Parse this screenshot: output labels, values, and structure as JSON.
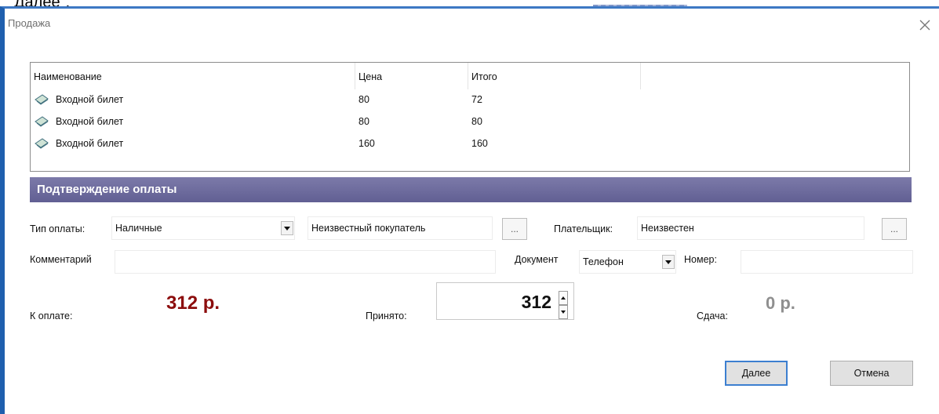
{
  "caption_top": "Далее\".",
  "window": {
    "title": "Продажа"
  },
  "table": {
    "columns": [
      "Наименование",
      "Цена",
      "Итого"
    ],
    "rows": [
      {
        "name": "Входной билет",
        "price": "80",
        "total": "72"
      },
      {
        "name": "Входной билет",
        "price": "80",
        "total": "80"
      },
      {
        "name": "Входной билет",
        "price": "160",
        "total": "160"
      }
    ]
  },
  "section": {
    "title": "Подтверждение оплаты"
  },
  "form": {
    "payment_type_label": "Тип оплаты:",
    "payment_type_value": "Наличные",
    "buyer_value": "Неизвестный покупатель",
    "payer_label": "Плательщик:",
    "payer_value": "Неизвестен",
    "comment_label": "Комментарий",
    "comment_value": "",
    "document_label": "Документ",
    "document_value": "Телефон",
    "number_label": "Номер:",
    "number_value": "",
    "ellipsis": "..."
  },
  "totals": {
    "to_pay_label": "К оплате:",
    "to_pay_value": "312 р.",
    "accepted_label": "Принято:",
    "accepted_value": "312",
    "change_label": "Сдача:",
    "change_value": "0 р."
  },
  "buttons": {
    "next": "Далее",
    "cancel": "Отмена"
  },
  "colors": {
    "section_bar": "#6b699b",
    "amount_red": "#8c0d0d",
    "window_border": "#1f5fae"
  }
}
